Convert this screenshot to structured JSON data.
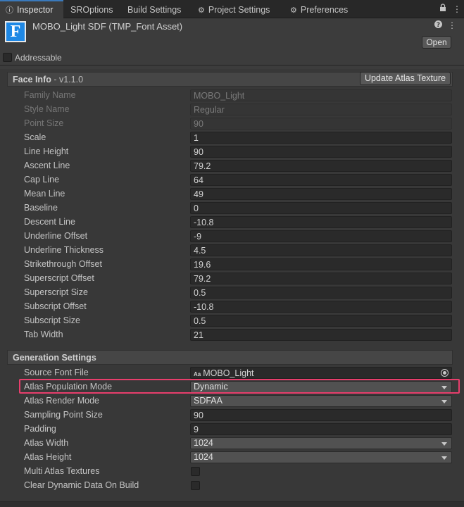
{
  "tabs": [
    {
      "label": "Inspector",
      "icon": "info-icon"
    },
    {
      "label": "SROptions"
    },
    {
      "label": "Build Settings"
    },
    {
      "label": "Project Settings",
      "icon": "gear-icon"
    },
    {
      "label": "Preferences",
      "icon": "gear-icon"
    }
  ],
  "header": {
    "icon_letter": "F",
    "title": "MOBO_Light SDF (TMP_Font Asset)",
    "open_label": "Open",
    "addressable_label": "Addressable"
  },
  "face_info": {
    "title": "Face Info",
    "version": " - v1.1.0",
    "update_button": "Update Atlas Texture",
    "rows": [
      {
        "label": "Family Name",
        "value": "MOBO_Light",
        "disabled": true
      },
      {
        "label": "Style Name",
        "value": "Regular",
        "disabled": true
      },
      {
        "label": "Point Size",
        "value": "90",
        "disabled": true
      },
      {
        "label": "Scale",
        "value": "1"
      },
      {
        "label": "Line Height",
        "value": "90"
      },
      {
        "label": "Ascent Line",
        "value": "79.2"
      },
      {
        "label": "Cap Line",
        "value": "64"
      },
      {
        "label": "Mean Line",
        "value": "49"
      },
      {
        "label": "Baseline",
        "value": "0"
      },
      {
        "label": "Descent Line",
        "value": "-10.8"
      },
      {
        "label": "Underline Offset",
        "value": "-9"
      },
      {
        "label": "Underline Thickness",
        "value": "4.5"
      },
      {
        "label": "Strikethrough Offset",
        "value": "19.6"
      },
      {
        "label": "Superscript Offset",
        "value": "79.2"
      },
      {
        "label": "Superscript Size",
        "value": "0.5"
      },
      {
        "label": "Subscript Offset",
        "value": "-10.8"
      },
      {
        "label": "Subscript Size",
        "value": "0.5"
      },
      {
        "label": "Tab Width",
        "value": "21"
      }
    ]
  },
  "generation": {
    "title": "Generation Settings",
    "source_font_label": "Source Font File",
    "source_font_value": "MOBO_Light",
    "source_font_glyph": "Aa",
    "population_label": "Atlas Population Mode",
    "population_value": "Dynamic",
    "render_label": "Atlas Render Mode",
    "render_value": "SDFAA",
    "sampling_label": "Sampling Point Size",
    "sampling_value": "90",
    "padding_label": "Padding",
    "padding_value": "9",
    "width_label": "Atlas Width",
    "width_value": "1024",
    "height_label": "Atlas Height",
    "height_value": "1024",
    "multi_label": "Multi Atlas Textures",
    "multi_checked": false,
    "clear_label": "Clear Dynamic Data On Build",
    "clear_checked": false
  }
}
